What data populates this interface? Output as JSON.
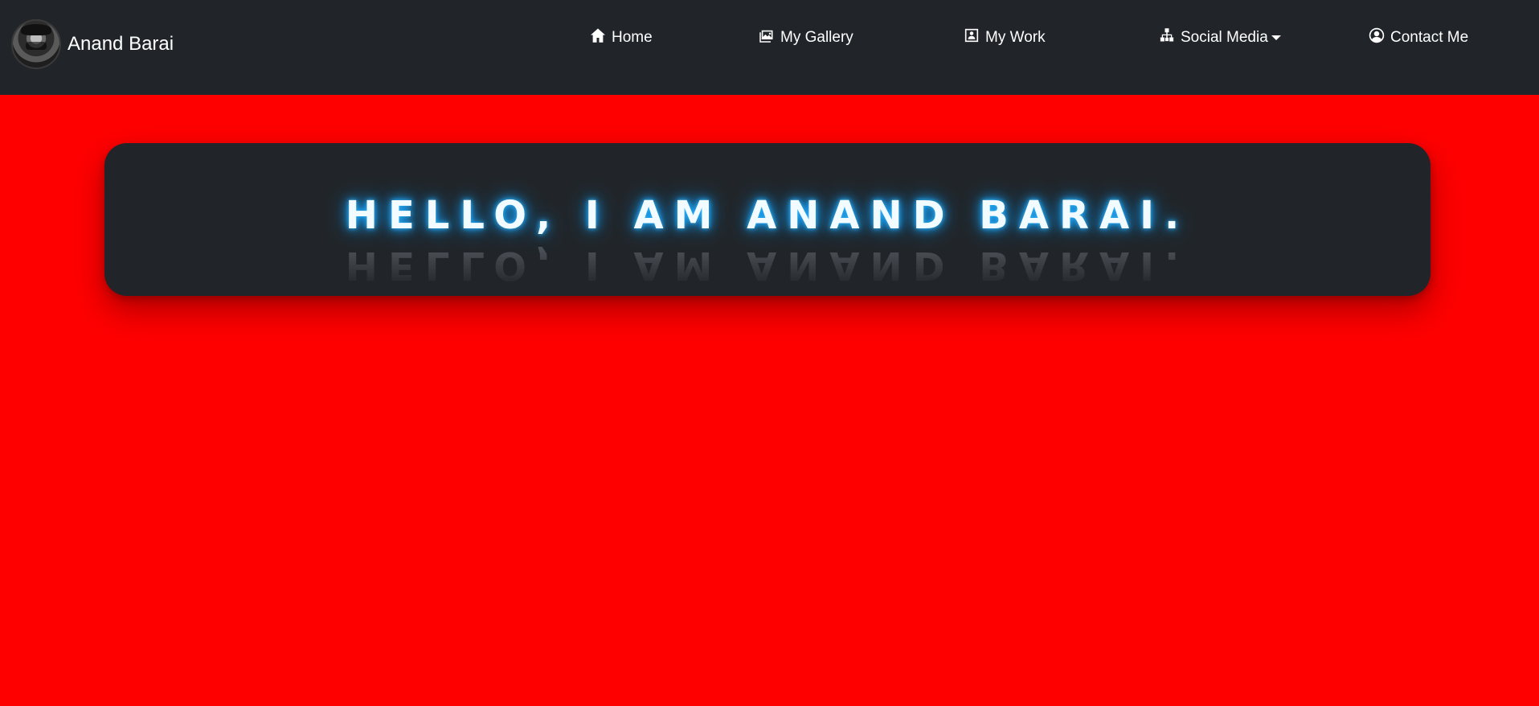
{
  "brand": {
    "name": "Anand Barai"
  },
  "nav": {
    "items": [
      {
        "label": "Home",
        "icon": "home-icon"
      },
      {
        "label": "My Gallery",
        "icon": "gallery-icon"
      },
      {
        "label": "My Work",
        "icon": "work-icon"
      },
      {
        "label": "Social Media",
        "icon": "social-network-icon",
        "dropdown": true
      },
      {
        "label": "Contact Me",
        "icon": "user-circle-icon"
      }
    ]
  },
  "hero": {
    "headline": "HELLO, I AM ANAND BARAI."
  },
  "colors": {
    "page_background": "#ff0000",
    "navbar_background": "#212529",
    "card_background": "#212529",
    "text": "#ffffff",
    "glow": "#1aa3ff"
  }
}
